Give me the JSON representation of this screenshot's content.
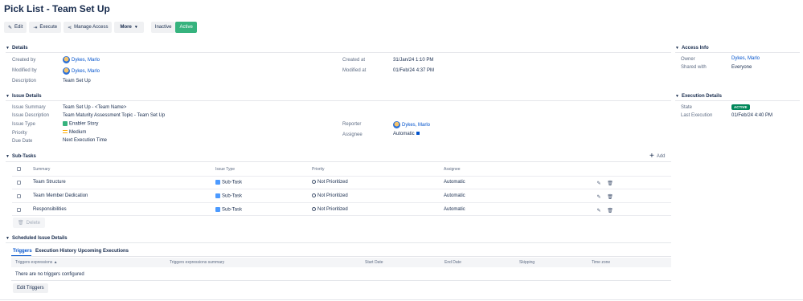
{
  "page": {
    "title": "Pick List - Team Set Up"
  },
  "toolbar": {
    "edit": "Edit",
    "execute": "Execute",
    "manage_access": "Manage Access",
    "more": "More",
    "inactive": "Inactive",
    "active": "Active"
  },
  "details": {
    "heading": "Details",
    "created_by_label": "Created by",
    "created_by": "Dykes, Marlo",
    "modified_by_label": "Modified by",
    "modified_by": "Dykes, Marlo",
    "description_label": "Description",
    "description": "Team Set Up",
    "created_at_label": "Created at",
    "created_at": "31/Jan/24 1:10 PM",
    "modified_at_label": "Modified at",
    "modified_at": "01/Feb/24 4:37 PM"
  },
  "access_info": {
    "heading": "Access Info",
    "owner_label": "Owner",
    "owner": "Dykes, Marlo",
    "shared_label": "Shared with",
    "shared": "Everyone"
  },
  "issue_details": {
    "heading": "Issue Details",
    "summary_label": "Issue Summary",
    "summary": "Team Set Up - <Team Name>",
    "description_label": "Issue Description",
    "description": "Team Maturity Assessment Topic - Team Set Up",
    "type_label": "Issue Type",
    "type": "Enabler Story",
    "priority_label": "Priority",
    "priority": "Medium",
    "due_label": "Due Date",
    "due": "Next Execution Time",
    "reporter_label": "Reporter",
    "reporter": "Dykes, Marlo",
    "assignee_label": "Assignee",
    "assignee": "Automatic"
  },
  "execution_details": {
    "heading": "Execution Details",
    "state_label": "State",
    "state": "ACTIVE",
    "last_label": "Last Execution",
    "last": "01/Feb/24 4:40 PM"
  },
  "subtasks": {
    "heading": "Sub-Tasks",
    "add": "Add",
    "columns": {
      "summary": "Summary",
      "type": "Issue Type",
      "priority": "Priority",
      "assignee": "Assignee"
    },
    "rows": [
      {
        "summary": "Team Structure",
        "type": "Sub-Task",
        "priority": "Not Prioritized",
        "assignee": "Automatic"
      },
      {
        "summary": "Team Member Dedication",
        "type": "Sub-Task",
        "priority": "Not Prioritized",
        "assignee": "Automatic"
      },
      {
        "summary": "Responsibilities",
        "type": "Sub-Task",
        "priority": "Not Prioritized",
        "assignee": "Automatic"
      }
    ],
    "delete": "Delete"
  },
  "scheduled": {
    "heading": "Scheduled Issue Details",
    "tabs": [
      "Triggers",
      "Execution History",
      "Upcoming Executions"
    ],
    "columns": {
      "expr": "Triggers expressions ▲",
      "summary": "Triggers expressions summary",
      "start": "Start Date",
      "end": "End Date",
      "skipping": "Skipping",
      "tz": "Time zone"
    },
    "empty": "There are no triggers configured",
    "edit": "Edit Triggers"
  }
}
